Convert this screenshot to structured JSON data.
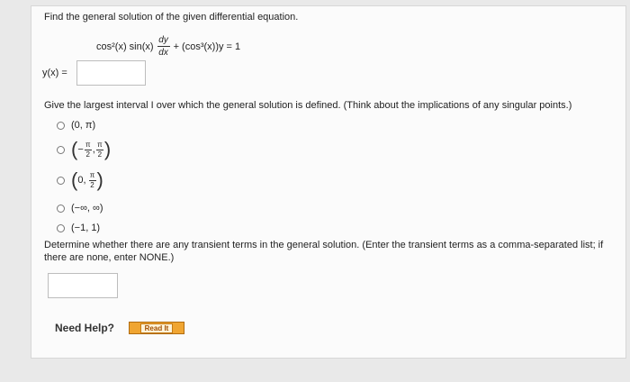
{
  "question": {
    "prompt": "Find the general solution of the given differential equation.",
    "equation": {
      "lhs_term1": "cos²(x) sin(x)",
      "deriv_num": "dy",
      "deriv_den": "dx",
      "rest": "+ (cos³(x))y = 1"
    },
    "answer_label": "y(x) ="
  },
  "interval": {
    "prompt": "Give the largest interval I over which the general solution is defined. (Think about the implications of any singular points.)",
    "options": [
      {
        "label": "(0, π)"
      },
      {
        "lparen": "(",
        "sign": "−",
        "num1": "π",
        "den1": "2",
        "comma": ",",
        "num2": "π",
        "den2": "2",
        "rparen": ")"
      },
      {
        "lparen": "(",
        "first": "0,",
        "num": "π",
        "den": "2",
        "rparen": ")"
      },
      {
        "label": "(−∞, ∞)"
      },
      {
        "label": "(−1, 1)"
      }
    ]
  },
  "transient": {
    "prompt": "Determine whether there are any transient terms in the general solution. (Enter the transient terms as a comma-separated list; if there are none, enter NONE.)"
  },
  "help": {
    "label": "Need Help?",
    "read_it": "Read It"
  },
  "colors": {
    "page_bg": "#e9e9e9",
    "panel_bg": "#fbfbfb",
    "read_it_orange": "#f0a531"
  }
}
